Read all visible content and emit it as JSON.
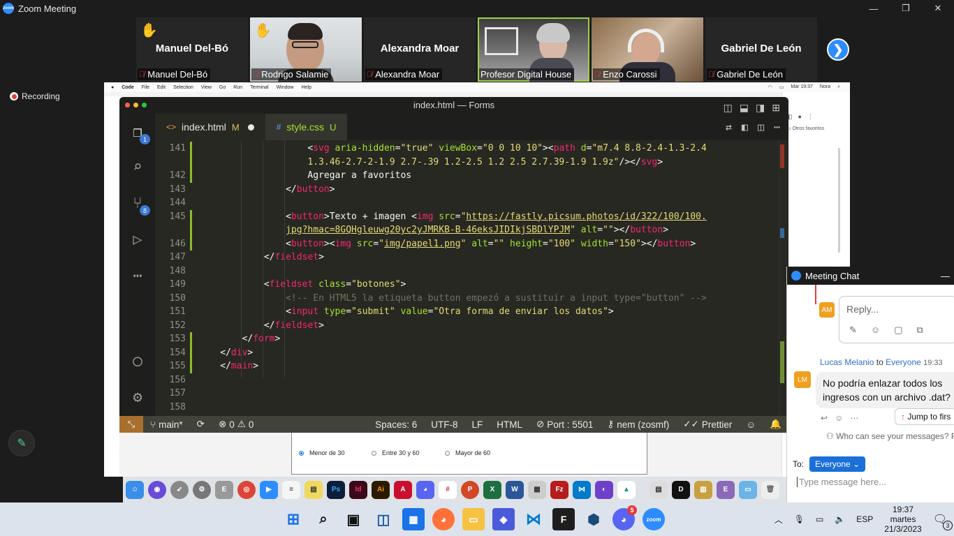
{
  "window": {
    "title": "Zoom Meeting",
    "controls": [
      "—",
      "❐",
      "✕"
    ]
  },
  "participants": [
    {
      "display": "Manuel Del-Bó",
      "caption": "Manuel Del-Bó",
      "hand": true,
      "video": false
    },
    {
      "display": "",
      "caption": "Rodrigo Salamie",
      "hand": true,
      "video": true
    },
    {
      "display": "Alexandra Moar",
      "caption": "Alexandra Moar",
      "hand": false,
      "video": false
    },
    {
      "display": "",
      "caption": "Profesor Digital House",
      "hand": false,
      "video": true,
      "active": true
    },
    {
      "display": "",
      "caption": "Enzo Carossi",
      "hand": false,
      "video": true
    },
    {
      "display": "Gabriel De León",
      "caption": "Gabriel De León",
      "hand": false,
      "video": false
    }
  ],
  "recording": {
    "label": "Recording"
  },
  "mac_menubar": {
    "items": [
      "Code",
      "File",
      "Edit",
      "Selection",
      "View",
      "Go",
      "Run",
      "Terminal",
      "Window",
      "Help"
    ],
    "clock": "Mar 19:37",
    "user": "Nora"
  },
  "browser": {
    "bookmark": "Otros favoritos"
  },
  "form_preview": {
    "options": [
      "Menor de 30",
      "Entre 30 y 60",
      "Mayor de 60"
    ]
  },
  "vscode": {
    "title": "index.html — Forms",
    "tabs": [
      {
        "label": "index.html",
        "status": "M",
        "icon": "<>"
      },
      {
        "label": "style.css",
        "status": "U",
        "icon": "#"
      }
    ],
    "activity_badges": {
      "explorer": "1",
      "source_control": "8"
    },
    "status": {
      "branch": "main*",
      "errors": "0",
      "warnings": "0",
      "spaces": "Spaces: 6",
      "encoding": "UTF-8",
      "eol": "LF",
      "language": "HTML",
      "port": "Port : 5501",
      "user": "nem (zosmf)",
      "prettier": "Prettier"
    }
  },
  "code_lines": [
    {
      "n": "141",
      "indent": 10,
      "html": "<span class='p'>&lt;</span><span class='t'>svg</span> <span class='a'>aria-hidden</span><span class='p'>=</span><span class='s'>\"true\"</span> <span class='a'>viewBox</span><span class='p'>=</span><span class='s'>\"0 0 10 10\"</span><span class='p'>&gt;&lt;</span><span class='t'>path</span> <span class='a'>d</span><span class='p'>=</span><span class='s'>\"m7.4 8.8-2.4-1.3-2.4</span>"
    },
    {
      "n": "",
      "indent": 10,
      "html": "<span class='s'>1.3.46-2.7-2-1.9 2.7-.39 1.2-2.5 1.2 2.5 2.7.39-1.9 1.9z\"</span><span class='p'>/&gt;&lt;/</span><span class='t'>svg</span><span class='p'>&gt;</span>"
    },
    {
      "n": "142",
      "indent": 10,
      "html": "<span class='p'>Agregar a favoritos</span>"
    },
    {
      "n": "143",
      "indent": 8,
      "html": "<span class='p'>&lt;/</span><span class='t'>button</span><span class='p'>&gt;</span>"
    },
    {
      "n": "144",
      "indent": 0,
      "html": ""
    },
    {
      "n": "145",
      "indent": 8,
      "html": "<span class='p'>&lt;</span><span class='t'>button</span><span class='p'>&gt;Texto + imagen &lt;</span><span class='t'>img</span> <span class='a'>src</span><span class='p'>=</span><span class='s'>\"<span class='u'>https://fastly.picsum.photos/id/322/100/100.</span></span>"
    },
    {
      "n": "",
      "indent": 8,
      "html": "<span class='s'><span class='u'>jpg?hmac=8GQHgleuwg20yc2yJMRKB-B-46eksJIDIkjSBDlYPJM</span>\"</span> <span class='a'>alt</span><span class='p'>=</span><span class='s'>\"\"</span><span class='p'>&gt;&lt;/</span><span class='t'>button</span><span class='p'>&gt;</span>"
    },
    {
      "n": "146",
      "indent": 8,
      "html": "<span class='p'>&lt;</span><span class='t'>button</span><span class='p'>&gt;&lt;</span><span class='t'>img</span> <span class='a'>src</span><span class='p'>=</span><span class='s'>\"<span class='u'>img/papel1.png</span>\"</span> <span class='a'>alt</span><span class='p'>=</span><span class='s'>\"\"</span> <span class='a'>height</span><span class='p'>=</span><span class='s'>\"100\"</span> <span class='a'>width</span><span class='p'>=</span><span class='s'>\"150\"</span><span class='p'>&gt;&lt;/</span><span class='t'>button</span><span class='p'>&gt;</span>"
    },
    {
      "n": "147",
      "indent": 6,
      "html": "<span class='p'>&lt;/</span><span class='t'>fieldset</span><span class='p'>&gt;</span>"
    },
    {
      "n": "148",
      "indent": 0,
      "html": ""
    },
    {
      "n": "149",
      "indent": 6,
      "html": "<span class='p'>&lt;</span><span class='t'>fieldset</span> <span class='a'>class</span><span class='p'>=</span><span class='s'>\"botones\"</span><span class='p'>&gt;</span>"
    },
    {
      "n": "150",
      "indent": 8,
      "html": "<span class='c'>&lt;!-- En HTML5 la etiqueta button empezó a sustituir a input type=\"button\" --&gt;</span>"
    },
    {
      "n": "151",
      "indent": 8,
      "html": "<span class='p'>&lt;</span><span class='t'>input</span> <span class='a'>type</span><span class='p'>=</span><span class='s'>\"submit\"</span> <span class='a'>value</span><span class='p'>=</span><span class='s'>\"Otra forma de enviar los datos\"</span><span class='p'>&gt;</span>"
    },
    {
      "n": "152",
      "indent": 6,
      "html": "<span class='p'>&lt;/</span><span class='t'>fieldset</span><span class='p'>&gt;</span>"
    },
    {
      "n": "153",
      "indent": 4,
      "html": "<span class='p'>&lt;/</span><span class='t'>form</span><span class='p'>&gt;</span>"
    },
    {
      "n": "154",
      "indent": 2,
      "html": "<span class='p'>&lt;/</span><span class='t'>div</span><span class='p'>&gt;</span>"
    },
    {
      "n": "155",
      "indent": 2,
      "html": "<span class='p'>&lt;/</span><span class='t'>main</span><span class='p'>&gt;</span>"
    },
    {
      "n": "156",
      "indent": 0,
      "html": ""
    },
    {
      "n": "157",
      "indent": 0,
      "html": ""
    },
    {
      "n": "158",
      "indent": 0,
      "html": ""
    }
  ],
  "chat": {
    "title": "Meeting Chat",
    "reply_avatar": "AM",
    "reply_placeholder": "Reply...",
    "message": {
      "avatar": "LM",
      "sender": "Lucas Melanio",
      "to_word": "to",
      "recipient": "Everyone",
      "time": "19:33",
      "text": "No podría enlazar todos los ingresos con un archivo .dat?"
    },
    "jump_label": "Jump to firs",
    "visibility": "Who can see your messages? Re",
    "to_label": "To:",
    "to_value": "Everyone",
    "input_placeholder": "Type message here..."
  },
  "taskbar": {
    "lang": "ESP",
    "time": "19:37",
    "day": "martes",
    "date": "21/3/2023",
    "discord_badge": "5",
    "notifications": "3"
  }
}
